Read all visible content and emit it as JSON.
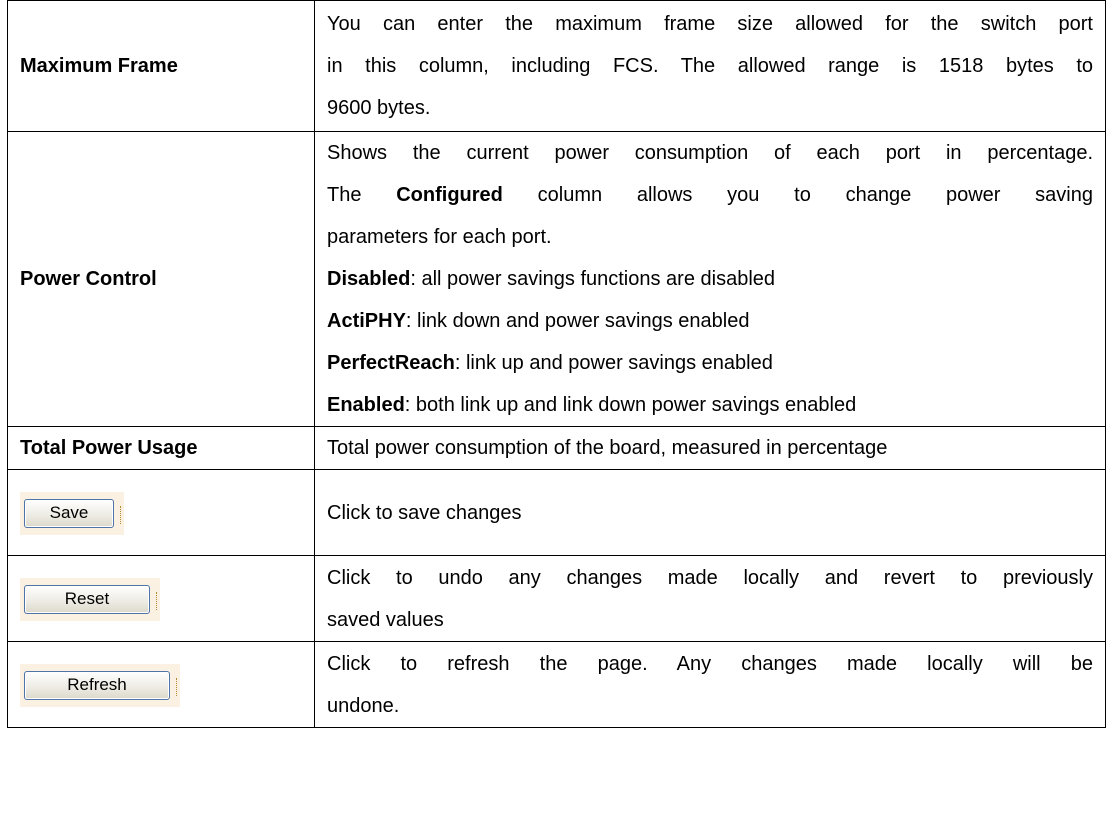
{
  "rows": {
    "maximum_frame": {
      "label": "Maximum Frame",
      "lines": [
        "You can enter the maximum frame size allowed for the switch port",
        "in this column, including FCS. The allowed range is 1518 bytes to",
        "9600 bytes."
      ]
    },
    "power_control": {
      "label": "Power Control",
      "line1": "Shows the current power consumption of each port in percentage.",
      "line2_prefix": "The",
      "line2_bold": "Configured",
      "line2_suffix": "column allows you to change power saving",
      "line3": "parameters for each port.",
      "options": [
        {
          "name": "Disabled",
          "desc": ": all power savings functions are disabled"
        },
        {
          "name": "ActiPHY",
          "desc": ": link down and power savings enabled"
        },
        {
          "name": "PerfectReach",
          "desc": ": link up and power savings enabled"
        },
        {
          "name": "Enabled",
          "desc": ": both link up and link down power savings enabled"
        }
      ]
    },
    "total_power": {
      "label": "Total Power Usage",
      "desc": "Total power consumption of the board, measured in percentage"
    },
    "save": {
      "button_label": "Save",
      "desc": "Click to save changes"
    },
    "reset": {
      "button_label": "Reset",
      "lines": [
        "Click to undo any changes made locally and revert to previously",
        "saved values"
      ]
    },
    "refresh": {
      "button_label": "Refresh",
      "lines": [
        "Click to refresh the page. Any changes made locally will be",
        "undone."
      ]
    }
  }
}
